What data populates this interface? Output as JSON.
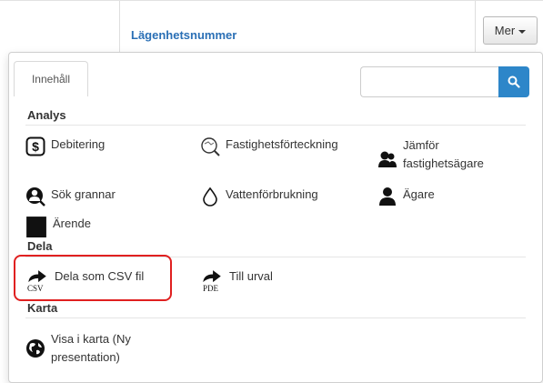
{
  "header": {
    "column_title": "Lägenhetsnummer",
    "more_label": "Mer"
  },
  "panel": {
    "tab_label": "Innehåll",
    "search": {
      "value": "",
      "placeholder": ""
    },
    "sections": {
      "analys": {
        "title": "Analys",
        "items": {
          "debitering": "Debitering",
          "fastighetsforteckning": "Fastighetsförteckning",
          "jamfor_line1": "Jämför",
          "jamfor_line2": "fastighetsägare",
          "sok_grannar": "Sök grannar",
          "vattenforbrukning": "Vattenförbrukning",
          "agare": "Ägare",
          "arende": "Ärende"
        }
      },
      "dela": {
        "title": "Dela",
        "items": {
          "csv": "Dela som CSV fil",
          "csv_badge": "CSV",
          "urval": "Till urval",
          "urval_badge": "PDE"
        }
      },
      "karta": {
        "title": "Karta",
        "items": {
          "visa_line1": "Visa i karta (Ny",
          "visa_line2": "presentation)"
        }
      }
    }
  },
  "colors": {
    "accent": "#2d86c9",
    "link": "#2a6fb5",
    "highlight": "#e02020"
  }
}
